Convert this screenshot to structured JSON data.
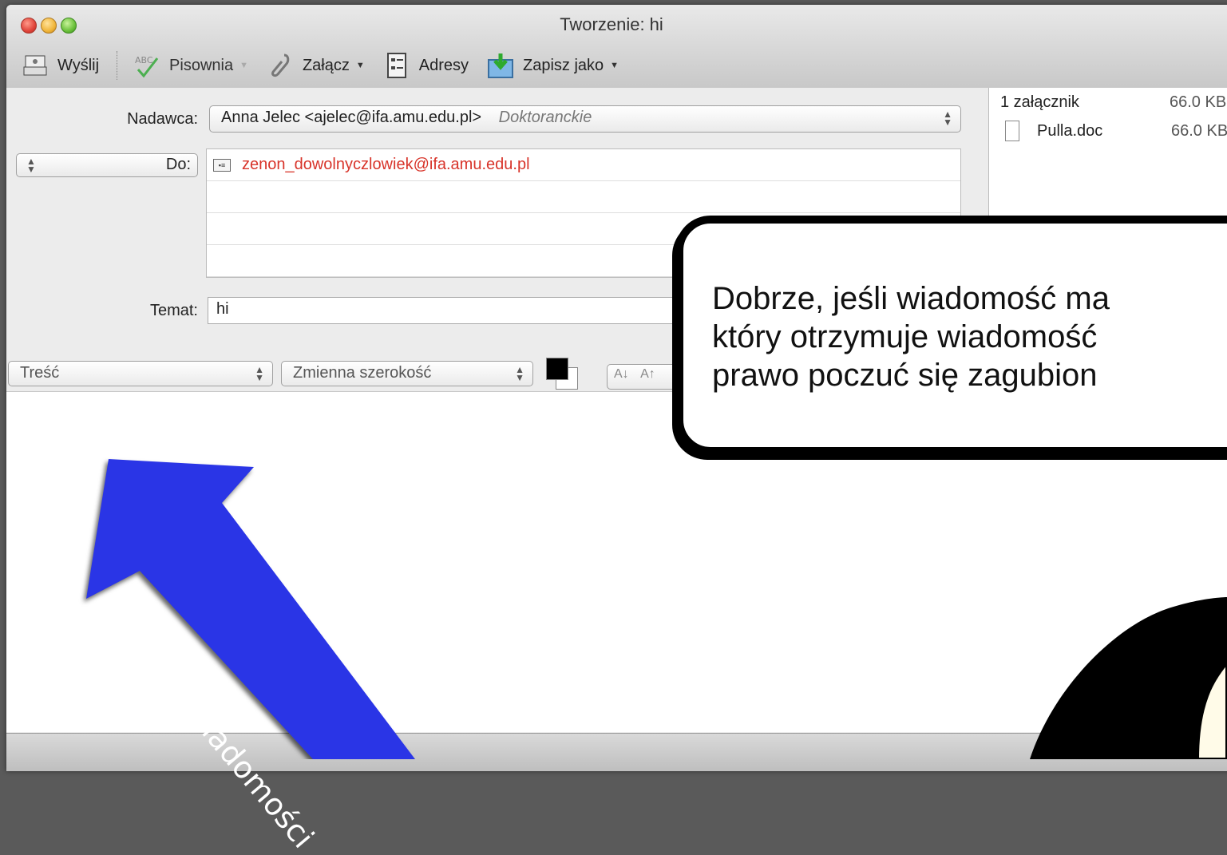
{
  "window": {
    "title": "Tworzenie: hi"
  },
  "toolbar": {
    "send_label": "Wyślij",
    "spelling_label": "Pisownia",
    "spelling_icon_text": "ABC",
    "attach_label": "Załącz",
    "addresses_label": "Adresy",
    "save_as_label": "Zapisz jako"
  },
  "header": {
    "from_label": "Nadawca:",
    "from_value": "Anna Jelec <ajelec@ifa.amu.edu.pl>",
    "from_account": "Doktoranckie",
    "to_label": "Do:",
    "to_recipient": "zenon_dowolnyczlowiek@ifa.amu.edu.pl",
    "subject_label": "Temat:",
    "subject_value": "hi"
  },
  "attachments": {
    "summary": "1 załącznik",
    "summary_size": "66.0 KB",
    "files": [
      {
        "name": "Pulla.doc",
        "size": "66.0 KB"
      }
    ]
  },
  "format_bar": {
    "style_value": "Treść",
    "width_value": "Zmienna szerokość",
    "font_smaller": "A↓",
    "font_larger": "A↑"
  },
  "callout": {
    "lines": [
      "Dobrze, jeśli wiadomość ma",
      "który otrzymuje wiadomość",
      "prawo poczuć się zagubion"
    ]
  },
  "annotation": {
    "arrow_label": "treść wiadomości",
    "arrow_color": "#2a35e6"
  }
}
